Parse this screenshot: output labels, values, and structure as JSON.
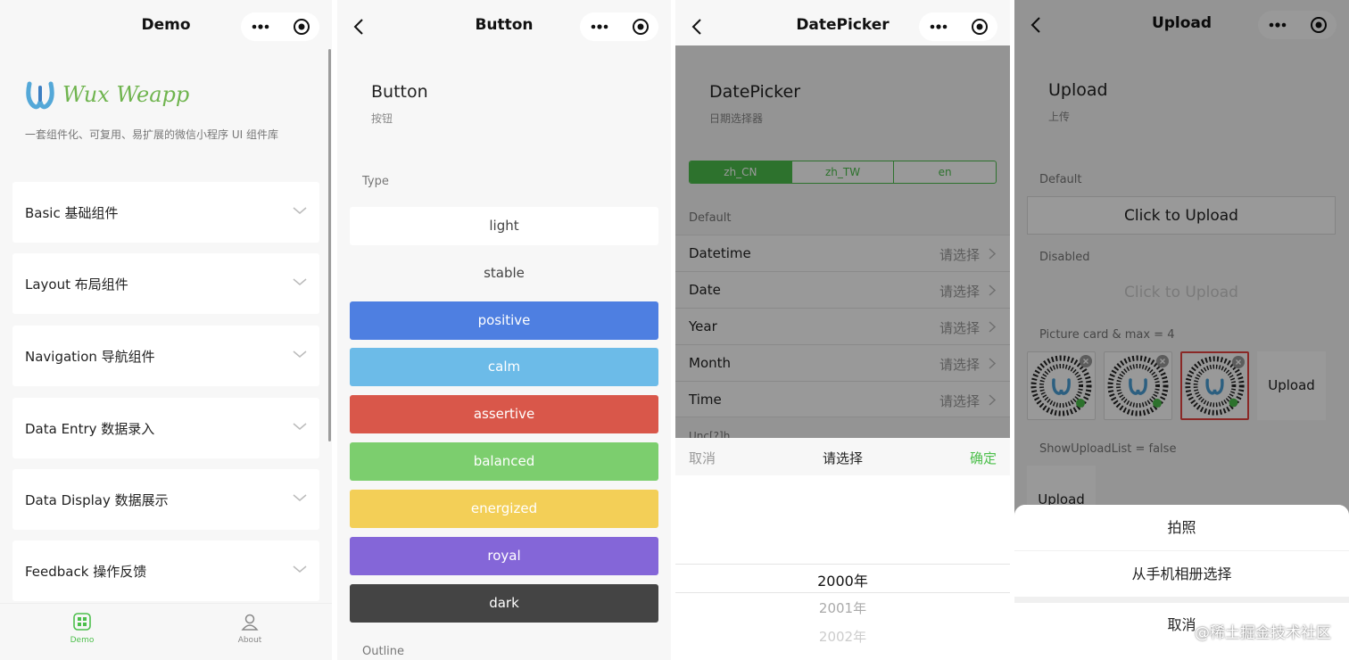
{
  "colors": {
    "brand_green": "#6fb44e",
    "primary_green": "#4cbf4b",
    "danger_red": "#e64340",
    "light": "#ffffff",
    "stable": "#f8f8f8",
    "positive": "#4e7fe1",
    "calm": "#6cbbe8",
    "assertive": "#d9574a",
    "balanced": "#7cce6e",
    "energized": "#f3cf57",
    "royal": "#8466d8",
    "dark": "#444444"
  },
  "demo": {
    "nav_title": "Demo",
    "brand": "Wux Weapp",
    "tagline": "一套组件化、可复用、易扩展的微信小程序 UI 组件库",
    "categories": [
      {
        "label": "Basic 基础组件"
      },
      {
        "label": "Layout 布局组件"
      },
      {
        "label": "Navigation 导航组件"
      },
      {
        "label": "Data Entry 数据录入"
      },
      {
        "label": "Data Display 数据展示"
      },
      {
        "label": "Feedback 操作反馈"
      }
    ],
    "tabs": [
      {
        "label": "Demo",
        "icon": "grid-icon",
        "active": true
      },
      {
        "label": "About",
        "icon": "user-icon",
        "active": false
      }
    ]
  },
  "button_page": {
    "nav_title": "Button",
    "title": "Button",
    "subtitle": "按钮",
    "section_type": "Type",
    "section_outline": "Outline",
    "buttons": [
      {
        "label": "light",
        "style": "light"
      },
      {
        "label": "stable",
        "style": "stable"
      },
      {
        "label": "positive",
        "style": "positive"
      },
      {
        "label": "calm",
        "style": "calm"
      },
      {
        "label": "assertive",
        "style": "assertive"
      },
      {
        "label": "balanced",
        "style": "balanced"
      },
      {
        "label": "energized",
        "style": "energized"
      },
      {
        "label": "royal",
        "style": "royal"
      },
      {
        "label": "dark",
        "style": "dark"
      }
    ]
  },
  "datepicker_page": {
    "nav_title": "DatePicker",
    "title": "DatePicker",
    "subtitle": "日期选择器",
    "lang_tabs": [
      {
        "label": "zh_CN",
        "active": true
      },
      {
        "label": "zh_TW",
        "active": false
      },
      {
        "label": "en",
        "active": false
      }
    ],
    "section_default": "Default",
    "section_partial": "Unc[?]h",
    "rows": [
      {
        "label": "Datetime",
        "value": "请选择"
      },
      {
        "label": "Date",
        "value": "请选择"
      },
      {
        "label": "Year",
        "value": "请选择"
      },
      {
        "label": "Month",
        "value": "请选择"
      },
      {
        "label": "Time",
        "value": "请选择"
      }
    ],
    "picker": {
      "cancel": "取消",
      "title": "请选择",
      "confirm": "确定",
      "options": [
        "2000年",
        "2001年",
        "2002年"
      ]
    }
  },
  "upload_page": {
    "nav_title": "Upload",
    "title": "Upload",
    "subtitle": "上传",
    "section_default": "Default",
    "default_button": "Click to Upload",
    "section_disabled": "Disabled",
    "disabled_button": "Click to Upload",
    "section_picture": "Picture card & max = 4",
    "picture_upload": "Upload",
    "section_showlist": "ShowUploadList = false",
    "showlist_upload": "Upload",
    "action_sheet": [
      "拍照",
      "从手机相册选择",
      "取消"
    ],
    "watermark": "@稀土掘金技术社区"
  }
}
